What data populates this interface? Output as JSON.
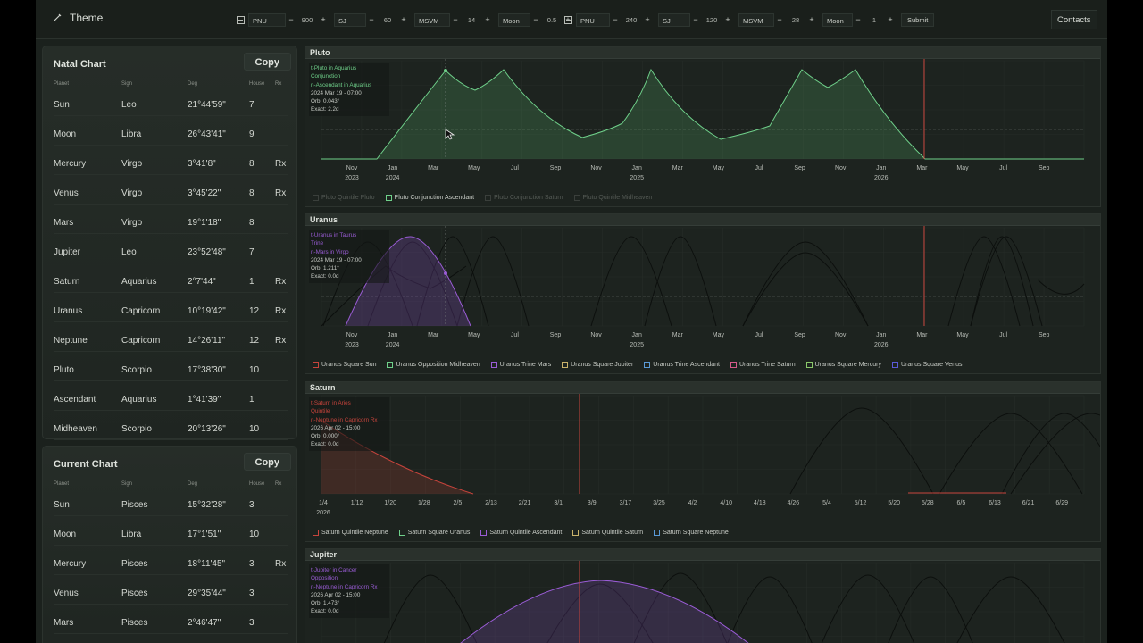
{
  "topbar": {
    "theme_label": "Theme",
    "controls_left": [
      {
        "label": "PNU",
        "value": "900"
      },
      {
        "label": "SJ",
        "value": "60"
      },
      {
        "label": "MSVM",
        "value": "14"
      },
      {
        "label": "Moon",
        "value": "0.5"
      }
    ],
    "controls_right": [
      {
        "label": "PNU",
        "value": "240"
      },
      {
        "label": "SJ",
        "value": "120"
      },
      {
        "label": "MSVM",
        "value": "28"
      },
      {
        "label": "Moon",
        "value": "1"
      }
    ],
    "submit_label": "Submit",
    "contacts_label": "Contacts"
  },
  "natal": {
    "title": "Natal Chart",
    "copy_label": "Copy",
    "headers": [
      "Planet",
      "Sign",
      "Deg",
      "House",
      "Rx"
    ],
    "rows": [
      [
        "Sun",
        "Leo",
        "21°44'59\"",
        "7",
        ""
      ],
      [
        "Moon",
        "Libra",
        "26°43'41\"",
        "9",
        ""
      ],
      [
        "Mercury",
        "Virgo",
        "3°41'8\"",
        "8",
        "Rx"
      ],
      [
        "Venus",
        "Virgo",
        "3°45'22\"",
        "8",
        "Rx"
      ],
      [
        "Mars",
        "Virgo",
        "19°1'18\"",
        "8",
        ""
      ],
      [
        "Jupiter",
        "Leo",
        "23°52'48\"",
        "7",
        ""
      ],
      [
        "Saturn",
        "Aquarius",
        "2°7'44\"",
        "1",
        "Rx"
      ],
      [
        "Uranus",
        "Capricorn",
        "10°19'42\"",
        "12",
        "Rx"
      ],
      [
        "Neptune",
        "Capricorn",
        "14°26'11\"",
        "12",
        "Rx"
      ],
      [
        "Pluto",
        "Scorpio",
        "17°38'30\"",
        "10",
        ""
      ],
      [
        "Ascendant",
        "Aquarius",
        "1°41'39\"",
        "1",
        ""
      ],
      [
        "Midheaven",
        "Scorpio",
        "20°13'26\"",
        "10",
        ""
      ]
    ]
  },
  "current": {
    "title": "Current Chart",
    "copy_label": "Copy",
    "headers": [
      "Planet",
      "Sign",
      "Deg",
      "House",
      "Rx"
    ],
    "rows": [
      [
        "Sun",
        "Pisces",
        "15°32'28\"",
        "3",
        ""
      ],
      [
        "Moon",
        "Libra",
        "17°1'51\"",
        "10",
        ""
      ],
      [
        "Mercury",
        "Pisces",
        "18°11'45\"",
        "3",
        "Rx"
      ],
      [
        "Venus",
        "Pisces",
        "29°35'44\"",
        "3",
        ""
      ],
      [
        "Mars",
        "Pisces",
        "2°46'47\"",
        "3",
        ""
      ]
    ]
  },
  "colors": {
    "green": "#6fd08a",
    "purple": "#9a5cd6",
    "red": "#c8443c",
    "dark_line": "#0c0f0d"
  },
  "charts": {
    "pluto": {
      "title": "Pluto",
      "tip": [
        "t-Pluto in Aquarius",
        "Conjunction",
        "n-Ascendant in Aquarius",
        "2024 Mar 19 - 07:00",
        "Orb: 0.043°",
        "Exact: 2.2d"
      ],
      "legend": [
        {
          "label": "Pluto Quintile Pluto",
          "color": "#3a3f3b",
          "active": false
        },
        {
          "label": "Pluto Conjunction Ascendant",
          "color": "#6fd08a",
          "active": true
        },
        {
          "label": "Pluto Conjunction Saturn",
          "color": "#3a3f3b",
          "active": false
        },
        {
          "label": "Pluto Quintile Midheaven",
          "color": "#3a3f3b",
          "active": false
        }
      ]
    },
    "uranus": {
      "title": "Uranus",
      "tip": [
        "t-Uranus in Taurus",
        "Trine",
        "n-Mars in Virgo",
        "2024 Mar 19 - 07:00",
        "Orb: 1.211°",
        "Exact: 0.0d"
      ],
      "legend": [
        {
          "label": "Uranus Square Sun",
          "color": "#c8443c",
          "active": true
        },
        {
          "label": "Uranus Opposition Midheaven",
          "color": "#6fd08a",
          "active": true
        },
        {
          "label": "Uranus Trine Mars",
          "color": "#9a5cd6",
          "active": true
        },
        {
          "label": "Uranus Square Jupiter",
          "color": "#c9b26a",
          "active": true
        },
        {
          "label": "Uranus Trine Ascendant",
          "color": "#5a9ad6",
          "active": true
        },
        {
          "label": "Uranus Trine Saturn",
          "color": "#d65a8a",
          "active": true
        },
        {
          "label": "Uranus Square Mercury",
          "color": "#8ac86a",
          "active": true
        },
        {
          "label": "Uranus Square Venus",
          "color": "#5a5ad6",
          "active": true
        }
      ]
    },
    "saturn": {
      "title": "Saturn",
      "tip": [
        "t-Saturn in Aries",
        "Quintile",
        "n-Neptune in Capricorn Rx",
        "2026 Apr 02 - 15:00",
        "Orb: 0.000°",
        "Exact: 0.0d"
      ],
      "legend": [
        {
          "label": "Saturn Quintile Neptune",
          "color": "#c8443c",
          "active": true
        },
        {
          "label": "Saturn Square Uranus",
          "color": "#6fd08a",
          "active": true
        },
        {
          "label": "Saturn Quintile Ascendant",
          "color": "#9a5cd6",
          "active": true
        },
        {
          "label": "Saturn Quintile Saturn",
          "color": "#c9b26a",
          "active": true
        },
        {
          "label": "Saturn Square Neptune",
          "color": "#5a9ad6",
          "active": true
        }
      ]
    },
    "jupiter": {
      "title": "Jupiter",
      "tip": [
        "t-Jupiter in Cancer",
        "Opposition",
        "n-Neptune in Capricorn Rx",
        "2026 Apr 02 - 15:00",
        "Orb: 1.473°",
        "Exact: 0.0d"
      ]
    },
    "long_axis": {
      "months": [
        "Nov",
        "Jan",
        "Mar",
        "May",
        "Jul",
        "Sep",
        "Nov",
        "Jan",
        "Mar",
        "May",
        "Jul",
        "Sep",
        "Nov",
        "Jan",
        "Mar",
        "May",
        "Jul",
        "Sep"
      ],
      "years": [
        {
          "label": "2023",
          "at": 0
        },
        {
          "label": "2024",
          "at": 1
        },
        {
          "label": "2025",
          "at": 7
        },
        {
          "label": "2026",
          "at": 13
        }
      ]
    },
    "short_axis": {
      "ticks": [
        "1/4",
        "1/12",
        "1/20",
        "1/28",
        "2/5",
        "2/13",
        "2/21",
        "3/1",
        "3/9",
        "3/17",
        "3/25",
        "4/2",
        "4/10",
        "4/18",
        "4/26",
        "5/4",
        "5/12",
        "5/20",
        "5/28",
        "6/5",
        "6/13",
        "6/21",
        "6/29"
      ],
      "year": "2026"
    }
  }
}
